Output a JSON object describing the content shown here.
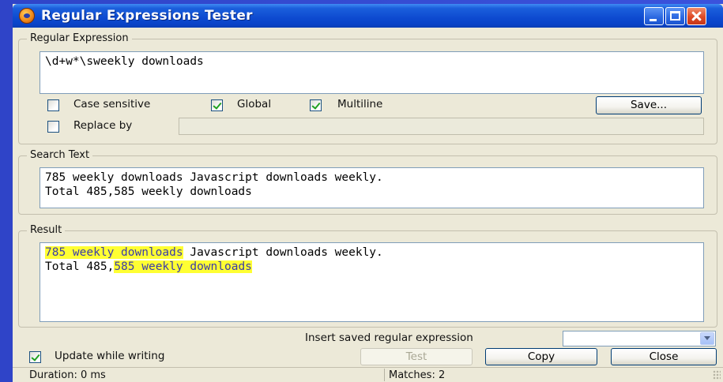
{
  "window": {
    "title": "Regular Expressions Tester"
  },
  "regex_group": {
    "legend": "Regular Expression",
    "pattern": "\\d+w*\\sweekly downloads",
    "case_sensitive": {
      "label": "Case sensitive",
      "checked": false
    },
    "global": {
      "label": "Global",
      "checked": true
    },
    "multiline": {
      "label": "Multiline",
      "checked": true
    },
    "save_label": "Save...",
    "replace_by": {
      "label": "Replace by",
      "checked": false,
      "value": ""
    }
  },
  "search_group": {
    "legend": "Search Text",
    "line1": "785 weekly downloads Javascript downloads weekly.",
    "line2": "Total 485,585 weekly downloads"
  },
  "result_group": {
    "legend": "Result",
    "line1_match": "785 weekly downloads",
    "line1_rest": " Javascript downloads weekly.",
    "line2_prefix": "Total 485,",
    "line2_match": "585 weekly downloads",
    "highlight_color": "#ffff33"
  },
  "bottom": {
    "insert_label": "Insert saved regular expression",
    "insert_value": "",
    "update_while_writing": {
      "label": "Update while writing",
      "checked": true
    },
    "test_label": "Test",
    "copy_label": "Copy",
    "close_label": "Close"
  },
  "status": {
    "duration": "Duration: 0 ms",
    "matches": "Matches: 2"
  },
  "icons": {
    "app": "firefox-icon",
    "minimize": "minimize-icon",
    "maximize": "maximize-icon",
    "close": "close-icon",
    "dropdown": "chevron-down-icon"
  }
}
